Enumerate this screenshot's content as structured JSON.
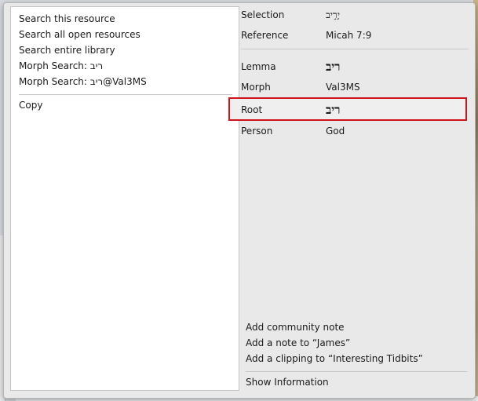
{
  "context_menu": {
    "items": [
      {
        "label": "Search this resource"
      },
      {
        "label": "Search all open resources"
      },
      {
        "label": "Search entire library"
      },
      {
        "label": "Morph Search: ריב"
      },
      {
        "label": "Morph Search: ריב@Val3MS"
      }
    ],
    "copy_label": "Copy"
  },
  "info": {
    "selection": {
      "label": "Selection",
      "value": "יָרִ֣יב"
    },
    "reference": {
      "label": "Reference",
      "value": "Micah 7:9"
    },
    "lemma": {
      "label": "Lemma",
      "value": "ריב"
    },
    "morph": {
      "label": "Morph",
      "value": "Val3MS"
    },
    "root": {
      "label": "Root",
      "value": "ריב"
    },
    "person": {
      "label": "Person",
      "value": "God"
    }
  },
  "actions": {
    "add_community_note": "Add community note",
    "add_note": "Add a note to “James”",
    "add_clipping": "Add a clipping to “Interesting Tidbits”",
    "show_information": "Show Information"
  },
  "colors": {
    "highlight_border": "#d0141c",
    "popup_bg": "#e9e9e9",
    "menu_bg": "#ffffff"
  }
}
